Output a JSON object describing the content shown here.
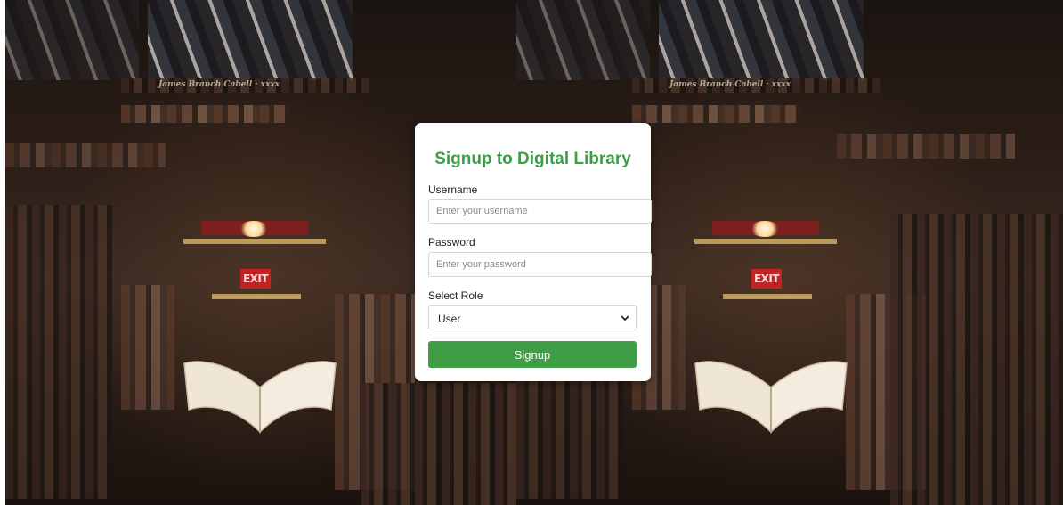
{
  "page": {
    "background_theme": "library bookshelves",
    "bg_spine_text": "James Branch Cabell · xxxx",
    "exit_sign_text": "EXIT"
  },
  "signup_form": {
    "title": "Signup to Digital Library",
    "username": {
      "label": "Username",
      "placeholder": "Enter your username",
      "value": ""
    },
    "password": {
      "label": "Password",
      "placeholder": "Enter your password",
      "value": ""
    },
    "role": {
      "label": "Select Role",
      "selected": "User",
      "icon": "chevron-down-icon"
    },
    "submit_label": "Signup"
  },
  "colors": {
    "title_green": "#3aa046",
    "button_green": "#3f9e45",
    "card_bg": "#ffffff"
  }
}
